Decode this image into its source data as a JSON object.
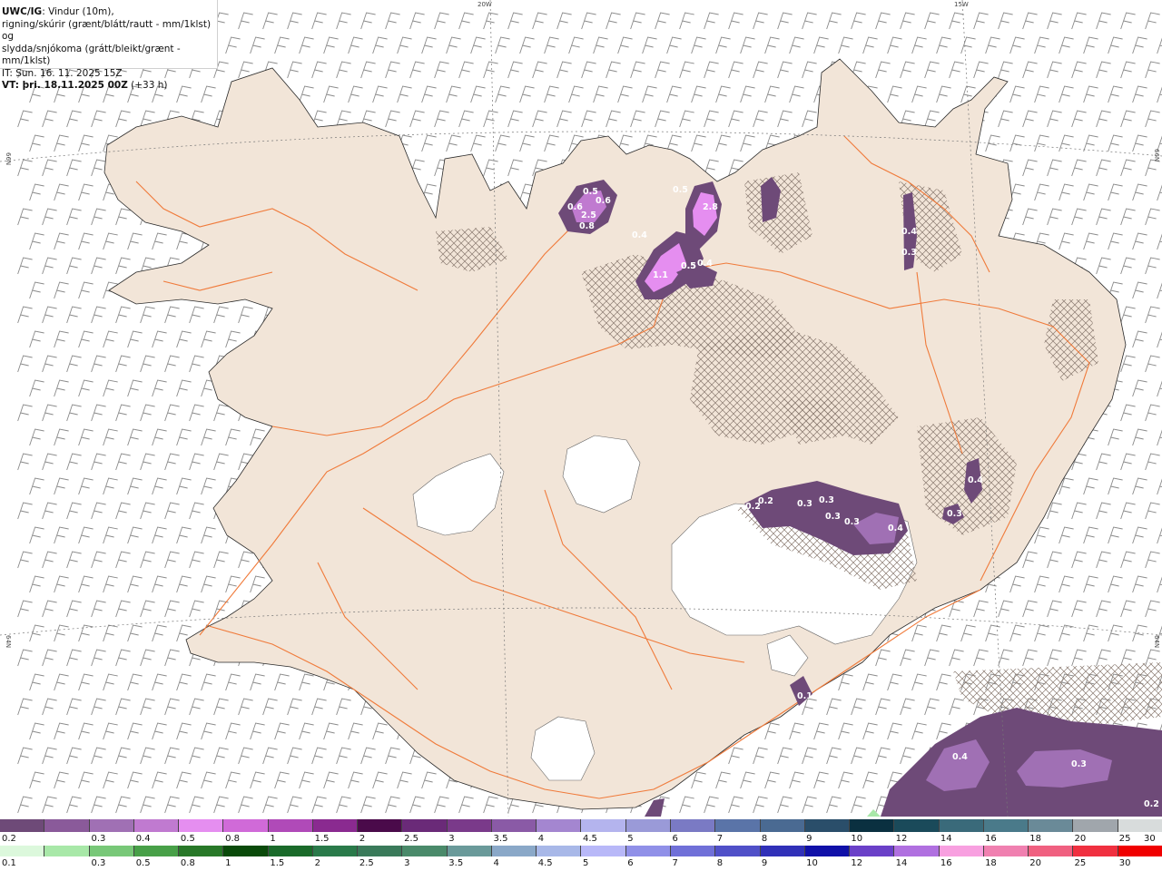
{
  "header": {
    "line1_bold": "UWC/IG",
    "line1_rest": ": Vindur (10m),",
    "line2": "rigning/skúrir (grænt/blátt/rautt - mm/1klst) og",
    "line3": "slydda/snjókoma (grátt/bleikt/grænt - mm/1klst)",
    "line4": "IT: Sun. 16. 11. 2025 15Z",
    "line5_bold": "VT: þri. 18.11.2025 00Z",
    "line5_rest": " (+33 h)"
  },
  "graticule": {
    "top_labels": [
      "20W",
      "15W"
    ],
    "side_labels": [
      "66N",
      "64N"
    ]
  },
  "precip_labels": [
    {
      "text": "0.5"
    },
    {
      "text": "0.6"
    },
    {
      "text": "0.6"
    },
    {
      "text": "0.8"
    },
    {
      "text": "2.5"
    },
    {
      "text": "0.4"
    },
    {
      "text": "0.5"
    },
    {
      "text": "2.8"
    },
    {
      "text": "0.5"
    },
    {
      "text": "1.1"
    },
    {
      "text": "0.5"
    },
    {
      "text": "0.4"
    },
    {
      "text": "0.4"
    },
    {
      "text": "0.3"
    },
    {
      "text": "0.4"
    },
    {
      "text": "0.2"
    },
    {
      "text": "0.2"
    },
    {
      "text": "0.3"
    },
    {
      "text": "0.3"
    },
    {
      "text": "0.3"
    },
    {
      "text": "0.3"
    },
    {
      "text": "0.4"
    },
    {
      "text": "0.3"
    },
    {
      "text": "0.1"
    },
    {
      "text": "0.4"
    },
    {
      "text": "0.3"
    },
    {
      "text": "0.2"
    }
  ],
  "legend_snow": {
    "labels": [
      "0.2",
      "0.3",
      "0.4",
      "0.5",
      "0.8",
      "1",
      "1.5",
      "2",
      "2.5",
      "3",
      "3.5",
      "4",
      "4.5",
      "5",
      "6",
      "7",
      "8",
      "9",
      "10",
      "12",
      "14",
      "16",
      "18",
      "20",
      "25",
      "30"
    ],
    "colors": [
      "#6e4a78",
      "#8a5a9a",
      "#a070b4",
      "#c07ad0",
      "#e58ef0",
      "#d06ad8",
      "#b04ab8",
      "#8a2a90",
      "#4a0a4a",
      "#6a2a78",
      "#7a3a8a",
      "#8a5aa6",
      "#a486d0",
      "#b4b4ee",
      "#9a9ad8",
      "#7a7ac4",
      "#5a74a8",
      "#4a6a92",
      "#2a4e6a",
      "#0a3040",
      "#1a4a5a",
      "#3a6a7a",
      "#4a7a8a",
      "#6a8a98",
      "#a0a6ac",
      "#d8dcdc"
    ]
  },
  "legend_rain": {
    "labels": [
      "0.1",
      "0.3",
      "0.5",
      "0.8",
      "1",
      "1.5",
      "2",
      "2.5",
      "3",
      "3.5",
      "4",
      "4.5",
      "5",
      "6",
      "7",
      "8",
      "9",
      "10",
      "12",
      "14",
      "16",
      "18",
      "20",
      "25",
      "30"
    ],
    "colors": [
      "#dcf8dc",
      "#a8e8a8",
      "#78c878",
      "#48a048",
      "#287828",
      "#0a4a0a",
      "#1a6a2a",
      "#2a7a4a",
      "#3a7a5a",
      "#4a8a6a",
      "#6a9a9a",
      "#8aa8c8",
      "#a8b8e8",
      "#b8b8f8",
      "#9090e8",
      "#7070d8",
      "#5050c8",
      "#3030b8",
      "#1010a8",
      "#6a40c8",
      "#b070e0",
      "#f8a0e0",
      "#f080b0",
      "#f06080",
      "#f03040",
      "#f00000"
    ]
  },
  "colors": {
    "land": "#f2e5d8",
    "sea": "#ffffff",
    "roads": "#f07a3a",
    "wind_barbs": "#8a8a8a",
    "glacier": "#ffffff"
  }
}
